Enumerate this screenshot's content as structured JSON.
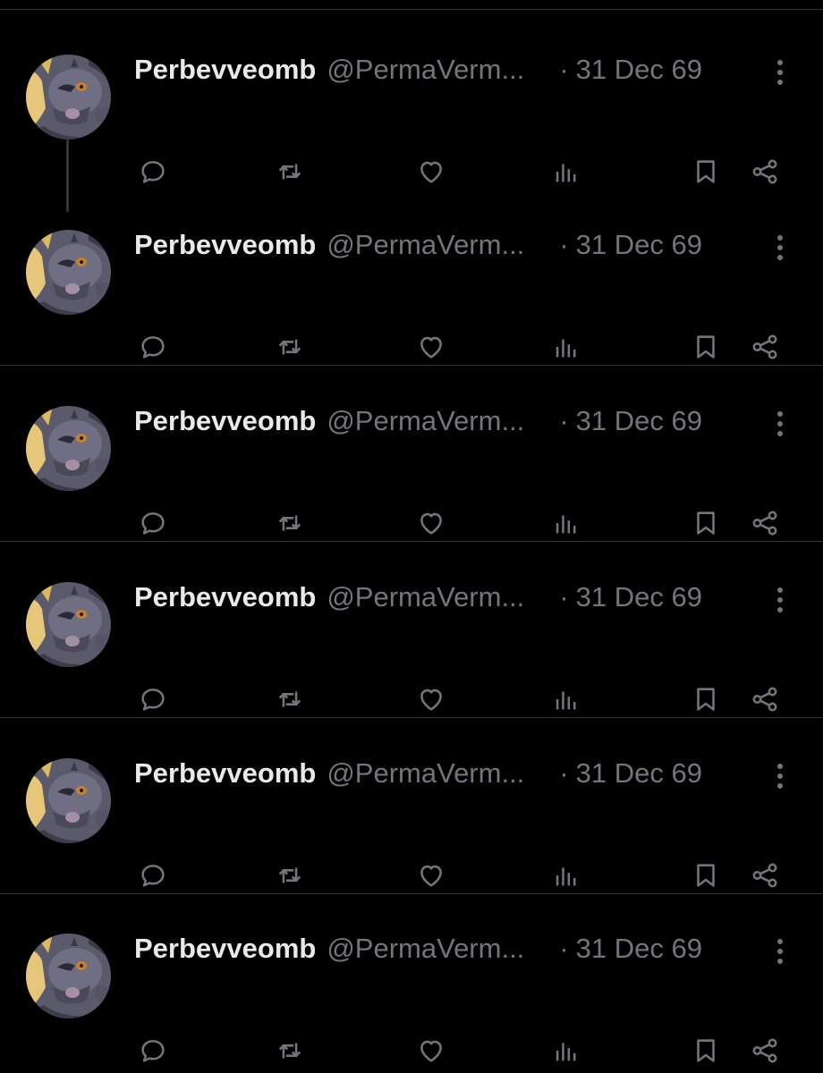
{
  "colors": {
    "background": "#000000",
    "divider": "#2f3336",
    "text_primary": "#e7e9ea",
    "text_secondary": "#71767b"
  },
  "icons": {
    "reply": "reply-icon",
    "repost": "repost-icon",
    "like": "heart-icon",
    "views": "analytics-icon",
    "bookmark": "bookmark-icon",
    "share": "share-icon",
    "more": "more-vertical-icon"
  },
  "posts": [
    {
      "display_name": "Perbevveomb",
      "handle": "@PermaVerm...",
      "separator": "·",
      "date": "31 Dec 69"
    },
    {
      "display_name": "Perbevveomb",
      "handle": "@PermaVerm...",
      "separator": "·",
      "date": "31 Dec 69"
    },
    {
      "display_name": "Perbevveomb",
      "handle": "@PermaVerm...",
      "separator": "·",
      "date": "31 Dec 69"
    },
    {
      "display_name": "Perbevveomb",
      "handle": "@PermaVerm...",
      "separator": "·",
      "date": "31 Dec 69"
    },
    {
      "display_name": "Perbevveomb",
      "handle": "@PermaVerm...",
      "separator": "·",
      "date": "31 Dec 69"
    },
    {
      "display_name": "Perbevveomb",
      "handle": "@PermaVerm...",
      "separator": "·",
      "date": "31 Dec 69"
    }
  ]
}
